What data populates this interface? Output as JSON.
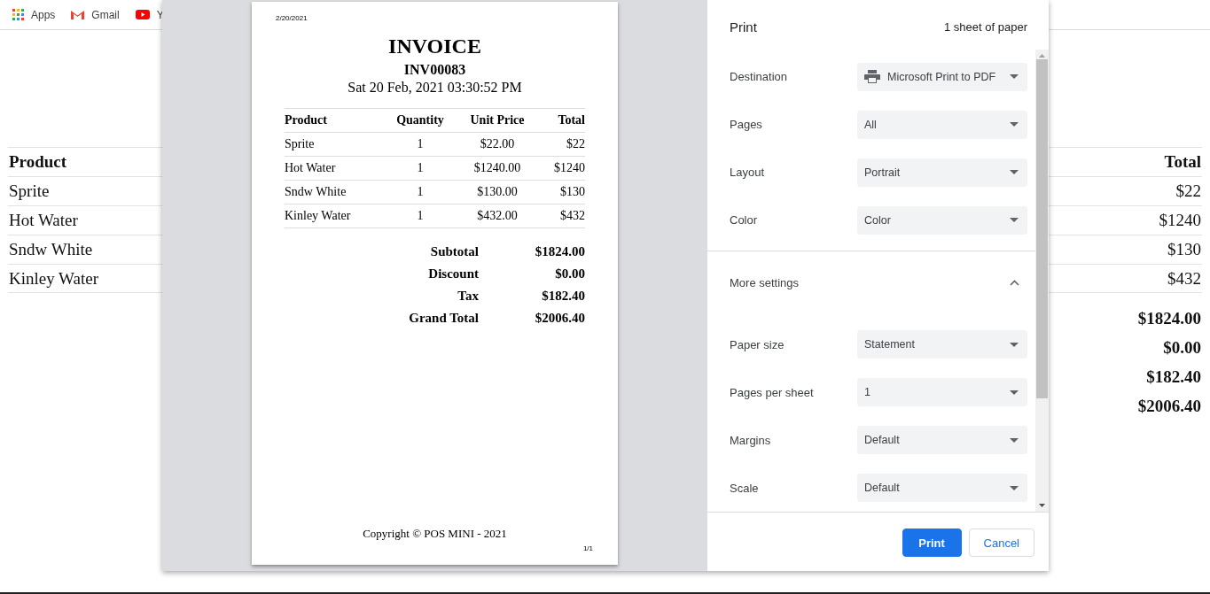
{
  "bookmarks": [
    {
      "label": "Apps",
      "kind": "apps"
    },
    {
      "label": "Gmail",
      "kind": "gmail"
    },
    {
      "label": "Y",
      "kind": "youtube"
    }
  ],
  "page_table": {
    "columns": [
      {
        "label": "Product"
      },
      {
        "label": "Total"
      }
    ],
    "rows": [
      {
        "product": "Sprite",
        "total": "$22"
      },
      {
        "product": "Hot Water",
        "total": "$1240"
      },
      {
        "product": "Sndw White",
        "total": "$130"
      },
      {
        "product": "Kinley Water",
        "total": "$432"
      }
    ],
    "summary": [
      "$1824.00",
      "$0.00",
      "$182.40",
      "$2006.40"
    ]
  },
  "print_dialog": {
    "preview": {
      "date": "2/20/2021",
      "title": "INVOICE",
      "number": "INV00083",
      "datetime": "Sat 20 Feb, 2021 03:30:52 PM",
      "columns": [
        "Product",
        "Quantity",
        "Unit Price",
        "Total"
      ],
      "rows": [
        [
          "Sprite",
          "1",
          "$22.00",
          "$22"
        ],
        [
          "Hot Water",
          "1",
          "$1240.00",
          "$1240"
        ],
        [
          "Sndw White",
          "1",
          "$130.00",
          "$130"
        ],
        [
          "Kinley Water",
          "1",
          "$432.00",
          "$432"
        ]
      ],
      "summary": [
        {
          "label": "Subtotal",
          "value": "$1824.00"
        },
        {
          "label": "Discount",
          "value": "$0.00"
        },
        {
          "label": "Tax",
          "value": "$182.40"
        },
        {
          "label": "Grand Total",
          "value": "$2006.40"
        }
      ],
      "footer": "Copyright © POS MINI - 2021",
      "page_number": "1/1"
    },
    "title": "Print",
    "sheet_count": "1 sheet of paper",
    "settings": [
      {
        "label": "Destination",
        "value": "Microsoft Print to PDF",
        "kind": "printer"
      },
      {
        "label": "Pages",
        "value": "All",
        "kind": "plain"
      },
      {
        "label": "Layout",
        "value": "Portrait",
        "kind": "plain"
      },
      {
        "label": "Color",
        "value": "Color",
        "kind": "plain"
      }
    ],
    "more_settings": {
      "label": "More settings",
      "expanded": true
    },
    "more": [
      {
        "label": "Paper size",
        "value": "Statement"
      },
      {
        "label": "Pages per sheet",
        "value": "1"
      },
      {
        "label": "Margins",
        "value": "Default"
      },
      {
        "label": "Scale",
        "value": "Default"
      }
    ],
    "buttons": [
      {
        "label": "Print",
        "kind": "primary"
      },
      {
        "label": "Cancel",
        "kind": "secondary"
      }
    ]
  }
}
